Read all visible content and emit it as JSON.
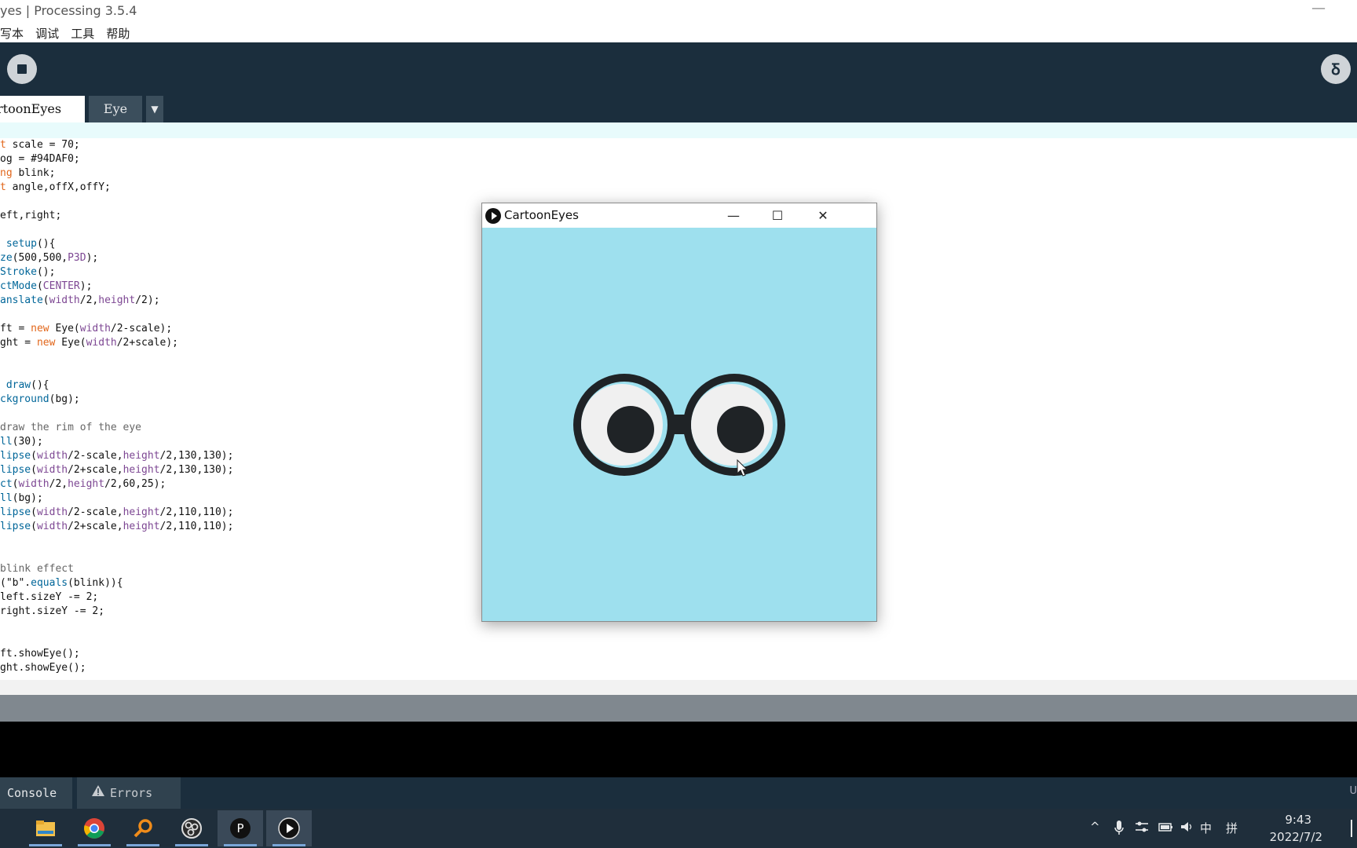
{
  "window": {
    "title": "yes | Processing 3.5.4",
    "minimize": "—"
  },
  "menu": [
    "写本",
    "调试",
    "工具",
    "帮助"
  ],
  "toolbar": {
    "mode_label": "Ᵹ"
  },
  "tabs": {
    "main": "rtoonEyes",
    "second": "Eye",
    "menu_arrow": "▼"
  },
  "code_lines": [
    [
      {
        "t": "t",
        "c": "kw"
      },
      {
        "t": " scale = 70;"
      }
    ],
    [
      {
        "t": "og = #94DAF0;"
      }
    ],
    [
      {
        "t": "ng",
        "c": "kw"
      },
      {
        "t": " blink;"
      }
    ],
    [
      {
        "t": "t",
        "c": "kw"
      },
      {
        "t": " angle,offX,offY;"
      }
    ],
    [
      {
        "t": ""
      }
    ],
    [
      {
        "t": "eft,right;"
      }
    ],
    [
      {
        "t": ""
      }
    ],
    [
      {
        "t": " "
      },
      {
        "t": "setup",
        "c": "fn"
      },
      {
        "t": "(){"
      }
    ],
    [
      {
        "t": "ze",
        "c": "fn"
      },
      {
        "t": "(500,500,"
      },
      {
        "t": "P3D",
        "c": "lit"
      },
      {
        "t": ");"
      }
    ],
    [
      {
        "t": "Stroke",
        "c": "fn"
      },
      {
        "t": "();"
      }
    ],
    [
      {
        "t": "ctMode",
        "c": "fn"
      },
      {
        "t": "("
      },
      {
        "t": "CENTER",
        "c": "lit"
      },
      {
        "t": ");"
      }
    ],
    [
      {
        "t": "anslate",
        "c": "fn"
      },
      {
        "t": "("
      },
      {
        "t": "width",
        "c": "lit"
      },
      {
        "t": "/2,"
      },
      {
        "t": "height",
        "c": "lit"
      },
      {
        "t": "/2);"
      }
    ],
    [
      {
        "t": ""
      }
    ],
    [
      {
        "t": "ft = "
      },
      {
        "t": "new",
        "c": "kw"
      },
      {
        "t": " Eye("
      },
      {
        "t": "width",
        "c": "lit"
      },
      {
        "t": "/2-scale);"
      }
    ],
    [
      {
        "t": "ght = "
      },
      {
        "t": "new",
        "c": "kw"
      },
      {
        "t": " Eye("
      },
      {
        "t": "width",
        "c": "lit"
      },
      {
        "t": "/2+scale);"
      }
    ],
    [
      {
        "t": ""
      }
    ],
    [
      {
        "t": ""
      }
    ],
    [
      {
        "t": " "
      },
      {
        "t": "draw",
        "c": "fn"
      },
      {
        "t": "(){"
      }
    ],
    [
      {
        "t": "ckground",
        "c": "fn"
      },
      {
        "t": "(bg);"
      }
    ],
    [
      {
        "t": ""
      }
    ],
    [
      {
        "t": "draw the rim of the eye",
        "c": "cm"
      }
    ],
    [
      {
        "t": "ll",
        "c": "fn"
      },
      {
        "t": "(30);"
      }
    ],
    [
      {
        "t": "lipse",
        "c": "fn"
      },
      {
        "t": "("
      },
      {
        "t": "width",
        "c": "lit"
      },
      {
        "t": "/2-scale,"
      },
      {
        "t": "height",
        "c": "lit"
      },
      {
        "t": "/2,130,130);"
      }
    ],
    [
      {
        "t": "lipse",
        "c": "fn"
      },
      {
        "t": "("
      },
      {
        "t": "width",
        "c": "lit"
      },
      {
        "t": "/2+scale,"
      },
      {
        "t": "height",
        "c": "lit"
      },
      {
        "t": "/2,130,130);"
      }
    ],
    [
      {
        "t": "ct",
        "c": "fn"
      },
      {
        "t": "("
      },
      {
        "t": "width",
        "c": "lit"
      },
      {
        "t": "/2,"
      },
      {
        "t": "height",
        "c": "lit"
      },
      {
        "t": "/2,60,25);"
      }
    ],
    [
      {
        "t": "ll",
        "c": "fn"
      },
      {
        "t": "(bg);"
      }
    ],
    [
      {
        "t": "lipse",
        "c": "fn"
      },
      {
        "t": "("
      },
      {
        "t": "width",
        "c": "lit"
      },
      {
        "t": "/2-scale,"
      },
      {
        "t": "height",
        "c": "lit"
      },
      {
        "t": "/2,110,110);"
      }
    ],
    [
      {
        "t": "lipse",
        "c": "fn"
      },
      {
        "t": "("
      },
      {
        "t": "width",
        "c": "lit"
      },
      {
        "t": "/2+scale,"
      },
      {
        "t": "height",
        "c": "lit"
      },
      {
        "t": "/2,110,110);"
      }
    ],
    [
      {
        "t": ""
      }
    ],
    [
      {
        "t": ""
      }
    ],
    [
      {
        "t": "blink effect",
        "c": "cm"
      }
    ],
    [
      {
        "t": "(\"b\"."
      },
      {
        "t": "equals",
        "c": "fn"
      },
      {
        "t": "(blink)){"
      }
    ],
    [
      {
        "t": "left.sizeY -= 2;"
      }
    ],
    [
      {
        "t": "right.sizeY -= 2;"
      }
    ],
    [
      {
        "t": ""
      }
    ],
    [
      {
        "t": ""
      }
    ],
    [
      {
        "t": "ft.showEye();"
      }
    ],
    [
      {
        "t": "ght.showEye();"
      }
    ]
  ],
  "console_tabs": {
    "console": "Console",
    "errors": "Errors",
    "right_edge": "U"
  },
  "taskbar": {
    "apps": [
      "file-explorer",
      "chrome",
      "search-tool",
      "obs",
      "processing-ide",
      "sketch-window"
    ],
    "tray": {
      "chevron": "^",
      "ime": "中",
      "ime2": "拼",
      "time": "9:43",
      "date": "2022/7/2"
    }
  },
  "sketch": {
    "title": "CartoonEyes",
    "minimize": "—",
    "maximize": "☐",
    "close": "✕",
    "bg_color": "#9ee0ee",
    "rim_color": "#1f2326",
    "white_color": "#f0f0f0",
    "pupil_color": "#1f2326"
  }
}
